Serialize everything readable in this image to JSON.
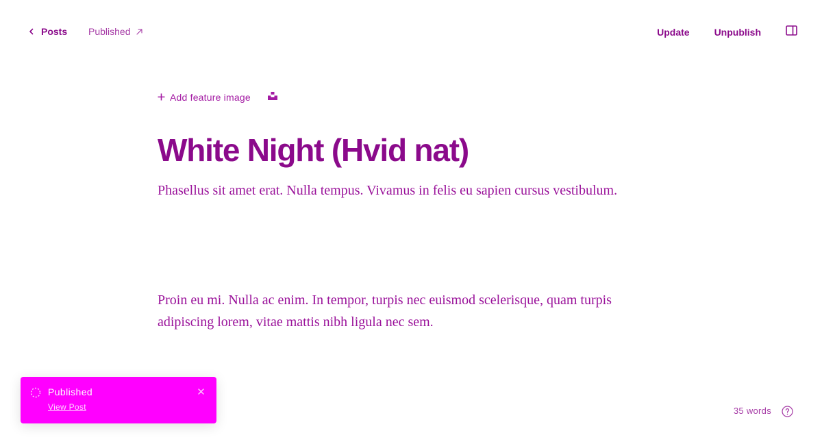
{
  "header": {
    "back_label": "Posts",
    "status_label": "Published",
    "update_label": "Update",
    "unpublish_label": "Unpublish"
  },
  "editor": {
    "add_feature_label": "Add feature image",
    "title": "White Night (Hvid nat)",
    "excerpt": "Phasellus sit amet erat. Nulla tempus. Vivamus in felis eu sapien cursus vestibulum.",
    "paragraphs": [
      "Proin eu mi. Nulla ac enim. In tempor, turpis nec euismod scelerisque, quam turpis adipiscing lorem, vitae mattis nibh ligula nec sem."
    ]
  },
  "toast": {
    "title": "Published",
    "link_label": "View Post"
  },
  "footer": {
    "word_count": "35 words"
  },
  "icons": {
    "back": "chevron-left-icon",
    "status": "arrow-up-right-icon",
    "sidebar": "sidebar-panel-icon",
    "add": "plus-icon",
    "unsplash": "unsplash-icon",
    "toast_status": "spinner-icon",
    "close": "close-icon",
    "help": "question-circle-icon"
  },
  "colors": {
    "accent": "#8b0a8b",
    "toast_background": "#ff00ff",
    "background": "#ffffff"
  }
}
